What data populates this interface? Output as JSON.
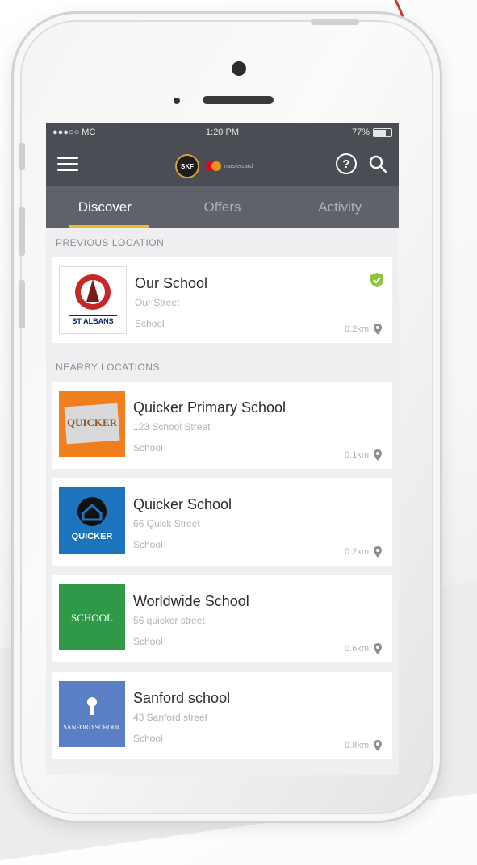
{
  "status_bar": {
    "carrier": "●●●○○ MC",
    "time": "1:20 PM",
    "battery": "77%",
    "battery_level": 0.77
  },
  "header": {
    "menu_icon": "hamburger-icon",
    "brand_logo_text": "SKF",
    "partner_logo_text": "mastercard",
    "help_icon": "help-circle-icon",
    "search_icon": "search-icon"
  },
  "tabs": [
    {
      "label": "Discover",
      "active": true
    },
    {
      "label": "Offers",
      "active": false
    },
    {
      "label": "Activity",
      "active": false
    }
  ],
  "previous_location": {
    "heading": "PREVIOUS LOCATION",
    "item": {
      "name": "Our School",
      "street": "Our Street",
      "type": "School",
      "distance": "0.2km",
      "logo_text": "ST ALBANS",
      "verified": true
    }
  },
  "nearby_locations": {
    "heading": "NEARBY LOCATIONS",
    "items": [
      {
        "name": "Quicker Primary School",
        "street": "123 School Street",
        "type": "School",
        "distance": "0.1km",
        "logo_text": "QUICKER",
        "logo_color": "#f07e1e"
      },
      {
        "name": "Quicker School",
        "street": "66 Quick Street",
        "type": "School",
        "distance": "0.2km",
        "logo_text": "QUICKER",
        "logo_color": "#1e74bc"
      },
      {
        "name": "Worldwide School",
        "street": "56 quicker street",
        "type": "School",
        "distance": "0.6km",
        "logo_text": "SCHOOL",
        "logo_color": "#2e9a47"
      },
      {
        "name": "Sanford school",
        "street": "43 Sanford street",
        "type": "School",
        "distance": "0.8km",
        "logo_text": "SANFORD SCHOOL",
        "logo_color": "#5b7fc4"
      }
    ]
  },
  "colors": {
    "header_bg": "#4a4d53",
    "tab_bg": "#5f6268",
    "tab_indicator": "#f2b632",
    "verified": "#8cc63f"
  }
}
